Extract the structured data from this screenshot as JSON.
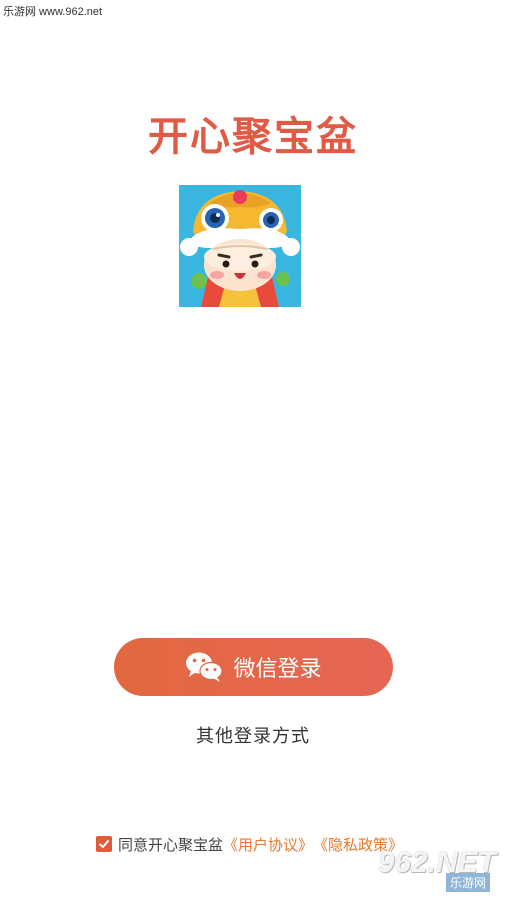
{
  "watermark_top": "乐游网 www.962.net",
  "app": {
    "title": "开心聚宝盆"
  },
  "login": {
    "wechat_label": "微信登录",
    "other_label": "其他登录方式"
  },
  "agreement": {
    "checked": true,
    "prefix": "同意开心聚宝盆",
    "user_agreement": "《用户协议》",
    "privacy_policy": "《隐私政策》"
  },
  "watermark_bottom": {
    "main": "962.NET",
    "sub": "乐游网"
  },
  "colors": {
    "accent": "#e05a45",
    "button_start": "#e2683e",
    "button_end": "#e66656",
    "link": "#e37a2f"
  }
}
